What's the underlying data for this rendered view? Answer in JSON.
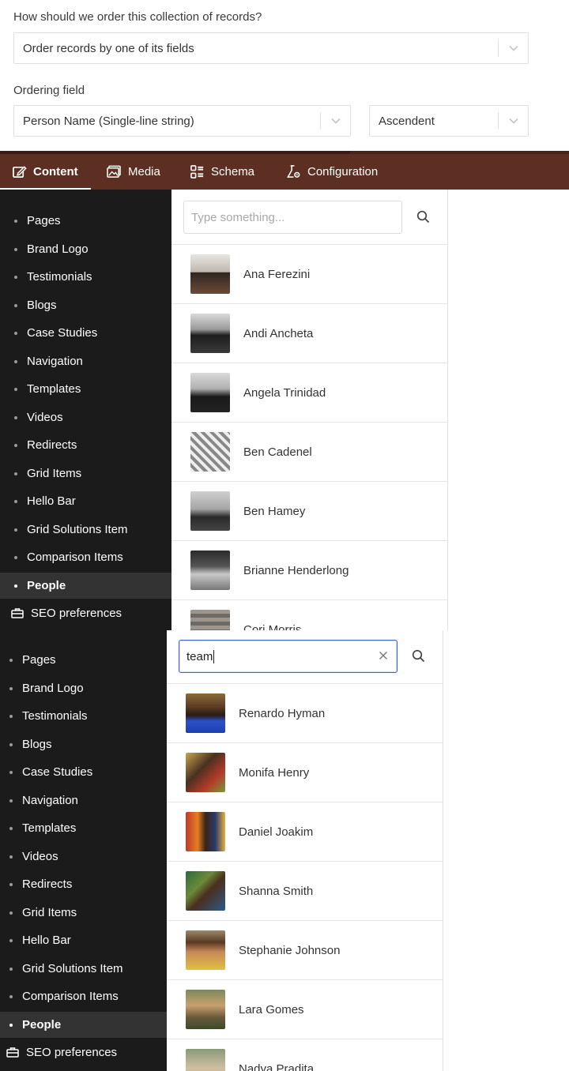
{
  "ordering": {
    "question": "How should we order this collection of records?",
    "mode_value": "Order records by one of its fields",
    "field_label": "Ordering field",
    "field_value": "Person Name (Single-line string)",
    "direction_value": "Ascendent"
  },
  "nav": {
    "tabs": [
      {
        "label": "Content",
        "icon": "edit-icon",
        "active": true
      },
      {
        "label": "Media",
        "icon": "image-icon"
      },
      {
        "label": "Schema",
        "icon": "schema-icon"
      },
      {
        "label": "Configuration",
        "icon": "flask-gear-icon"
      }
    ]
  },
  "sidebar": {
    "items": [
      "Pages",
      "Brand Logo",
      "Testimonials",
      "Blogs",
      "Case Studies",
      "Navigation",
      "Templates",
      "Videos",
      "Redirects",
      "Grid Items",
      "Hello Bar",
      "Grid Solutions Item",
      "Comparison Items",
      "People"
    ],
    "active": "People",
    "seo_label": "SEO preferences"
  },
  "list1": {
    "search_placeholder": "Type something...",
    "records": [
      "Ana Ferezini",
      "Andi Ancheta",
      "Angela Trinidad",
      "Ben Cadenel",
      "Ben Hamey",
      "Brianne Henderlong",
      "Cori Morris"
    ]
  },
  "list2": {
    "search_value": "team",
    "records": [
      "Renardo Hyman",
      "Monifa Henry",
      "Daniel Joakim",
      "Shanna Smith",
      "Stephanie Johnson",
      "Lara Gomes",
      "Nadya Pradita"
    ]
  },
  "colors": {
    "navbar": "#5c2f22",
    "sidebar": "#1b1b1b",
    "focus": "#3b63c8"
  }
}
